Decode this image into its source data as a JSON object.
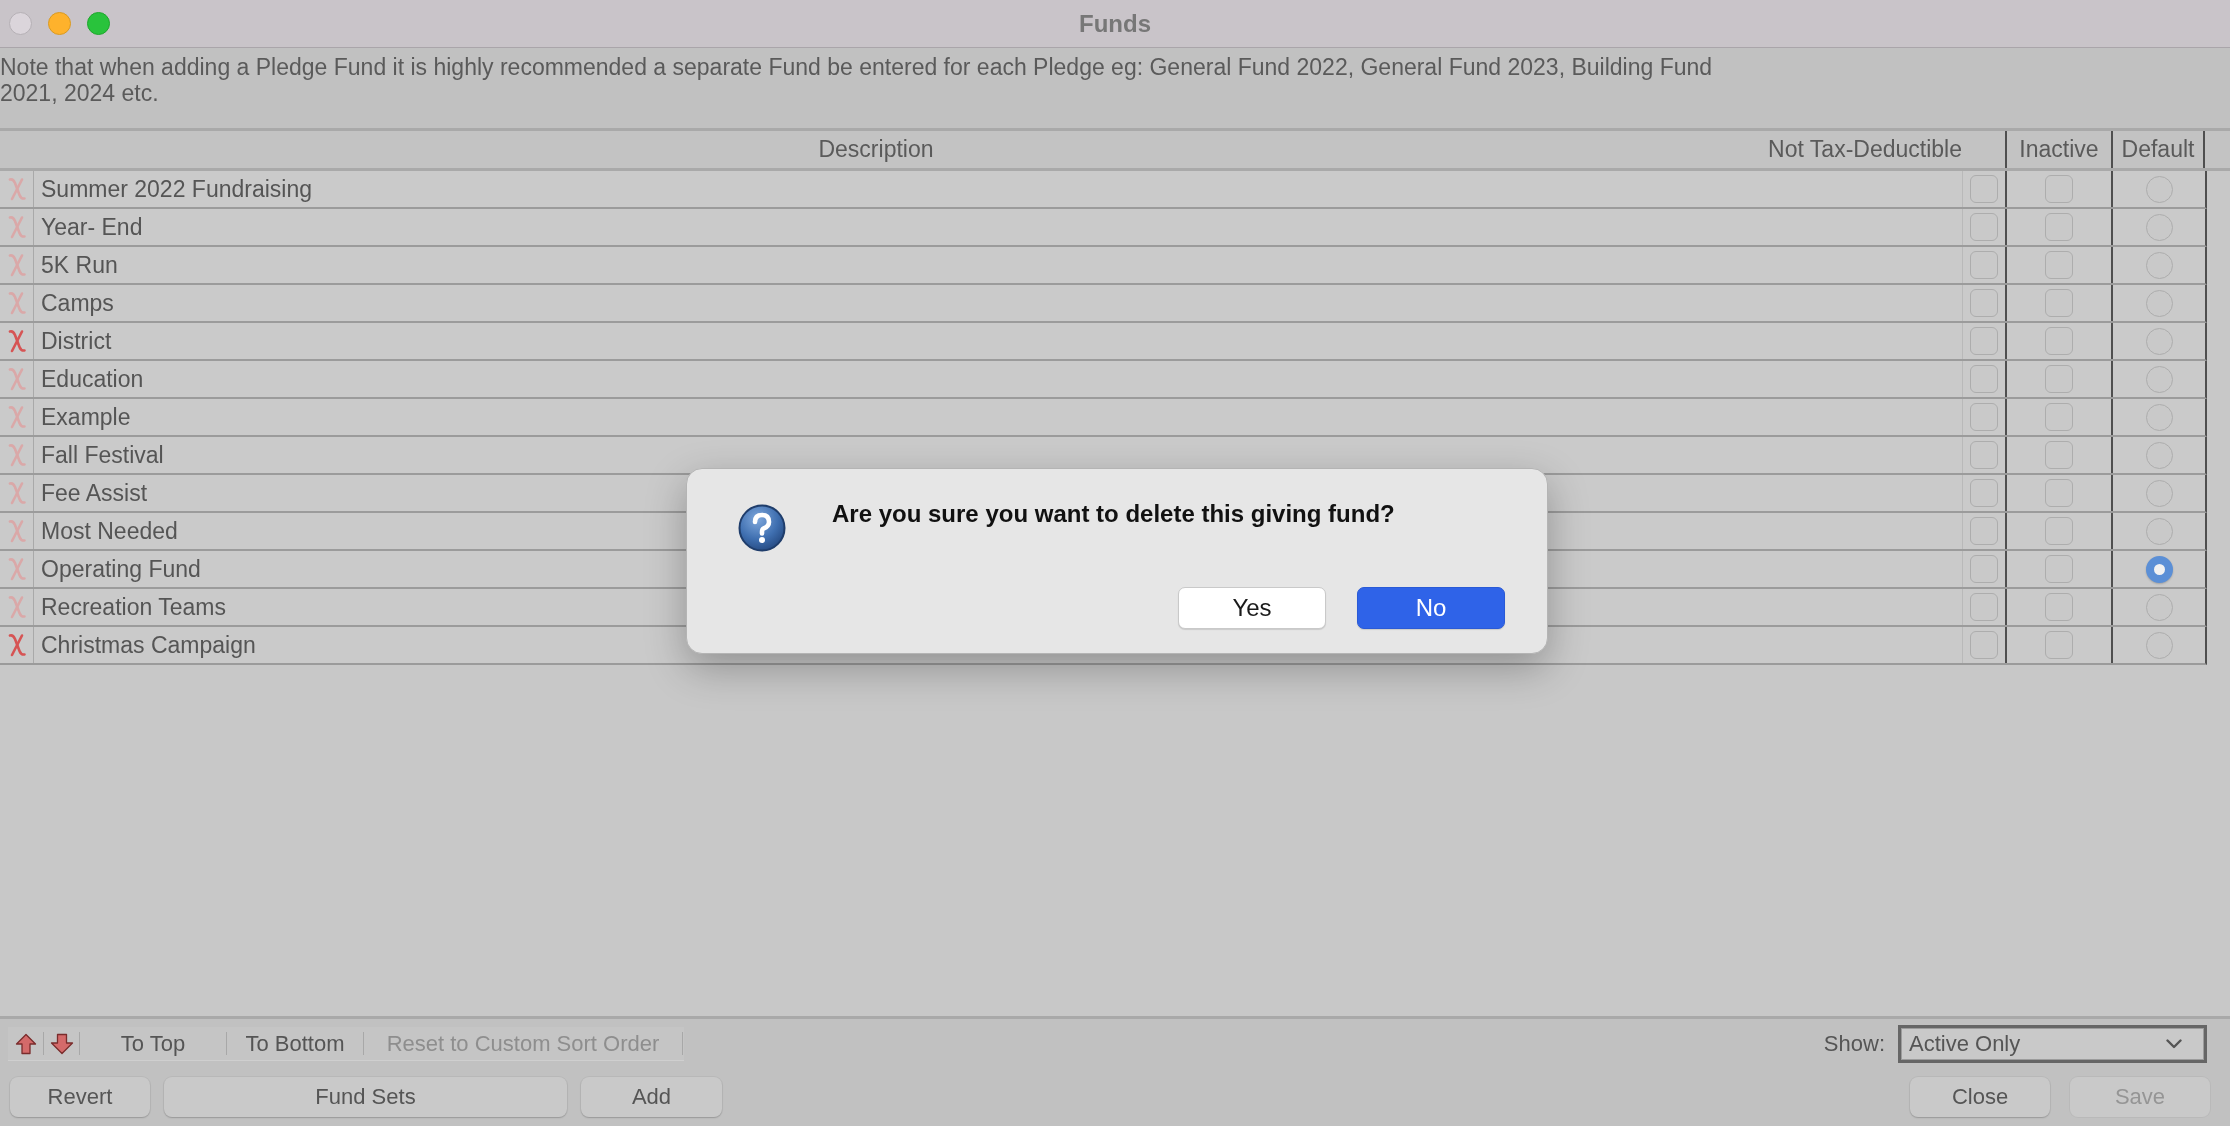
{
  "window": {
    "title": "Funds",
    "close_enabled": false
  },
  "note": "Note that when adding a Pledge Fund it is highly recommended a separate Fund be entered for each Pledge eg: General Fund 2022, General Fund 2023, Building Fund 2021, 2024 etc.",
  "table": {
    "columns": [
      "Description",
      "Not Tax-Deductible",
      "Inactive",
      "Default"
    ],
    "rows": [
      {
        "description": "Summer 2022 Fundraising",
        "delete_enabled": false,
        "not_tax_deductible": false,
        "inactive": false,
        "default": false
      },
      {
        "description": "Year- End",
        "delete_enabled": false,
        "not_tax_deductible": false,
        "inactive": false,
        "default": false
      },
      {
        "description": "5K Run",
        "delete_enabled": false,
        "not_tax_deductible": false,
        "inactive": false,
        "default": false
      },
      {
        "description": "Camps",
        "delete_enabled": false,
        "not_tax_deductible": false,
        "inactive": false,
        "default": false
      },
      {
        "description": "District",
        "delete_enabled": true,
        "not_tax_deductible": false,
        "inactive": false,
        "default": false
      },
      {
        "description": "Education",
        "delete_enabled": false,
        "not_tax_deductible": false,
        "inactive": false,
        "default": false
      },
      {
        "description": "Example",
        "delete_enabled": false,
        "not_tax_deductible": false,
        "inactive": false,
        "default": false
      },
      {
        "description": "Fall Festival",
        "delete_enabled": false,
        "not_tax_deductible": false,
        "inactive": false,
        "default": false
      },
      {
        "description": "Fee Assist",
        "delete_enabled": false,
        "not_tax_deductible": false,
        "inactive": false,
        "default": false
      },
      {
        "description": "Most Needed",
        "delete_enabled": false,
        "not_tax_deductible": false,
        "inactive": false,
        "default": false
      },
      {
        "description": "Operating Fund",
        "delete_enabled": false,
        "not_tax_deductible": false,
        "inactive": false,
        "default": true
      },
      {
        "description": "Recreation Teams",
        "delete_enabled": false,
        "not_tax_deductible": false,
        "inactive": false,
        "default": false
      },
      {
        "description": "Christmas Campaign",
        "delete_enabled": true,
        "not_tax_deductible": false,
        "inactive": false,
        "default": false
      }
    ]
  },
  "sort_toolbar": {
    "buttons": [
      {
        "label": "To Top",
        "disabled": false
      },
      {
        "label": "To Bottom",
        "disabled": false
      },
      {
        "label": "Reset to Custom Sort Order",
        "disabled": true
      }
    ]
  },
  "show_filter": {
    "label": "Show:",
    "value": "Active Only"
  },
  "buttons_left": [
    {
      "label": "Revert",
      "disabled": false
    },
    {
      "label": "Fund Sets",
      "disabled": false
    },
    {
      "label": "Add",
      "disabled": false
    }
  ],
  "buttons_right": [
    {
      "label": "Close",
      "disabled": false
    },
    {
      "label": "Save",
      "disabled": true
    }
  ],
  "dialog": {
    "message": "Are you sure you want to delete this giving fund?",
    "buttons": [
      {
        "label": "Yes",
        "default": false
      },
      {
        "label": "No",
        "default": true
      }
    ]
  }
}
